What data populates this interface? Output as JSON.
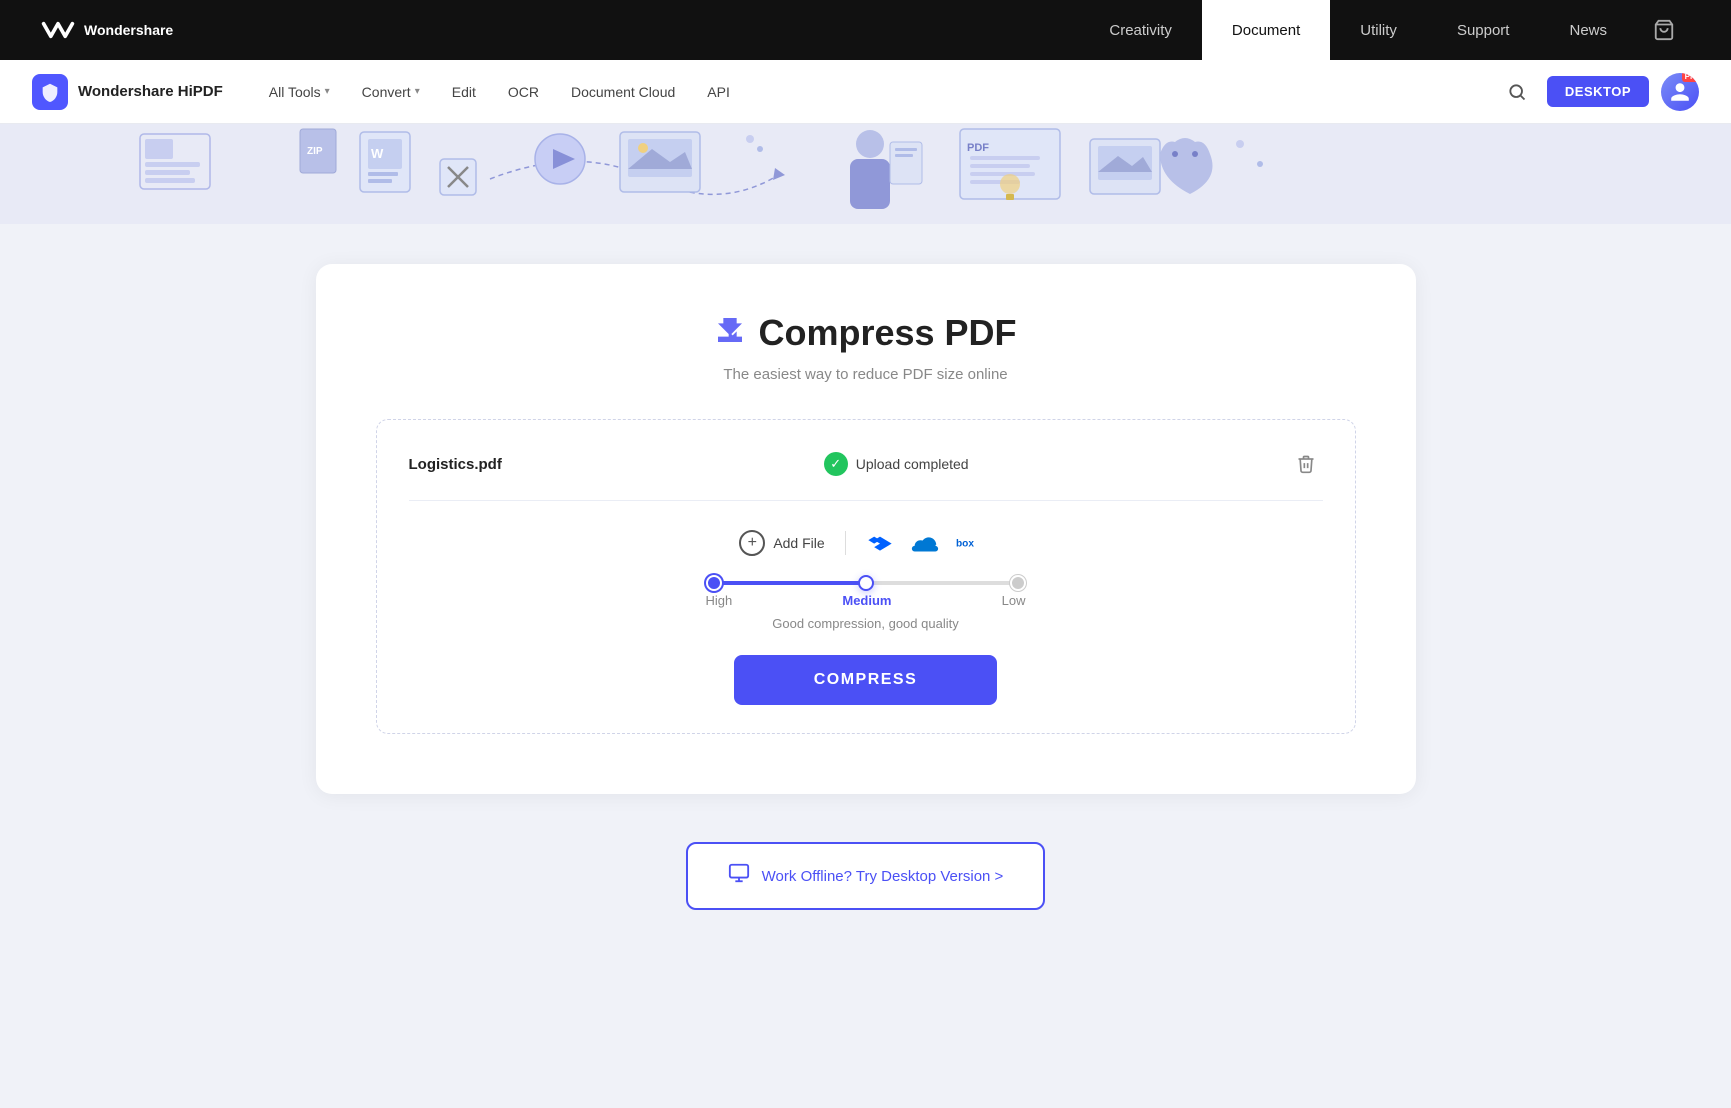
{
  "topNav": {
    "logo": "wondershare",
    "links": [
      {
        "id": "creativity",
        "label": "Creativity",
        "active": false
      },
      {
        "id": "document",
        "label": "Document",
        "active": true
      },
      {
        "id": "utility",
        "label": "Utility",
        "active": false
      },
      {
        "id": "support",
        "label": "Support",
        "active": false
      },
      {
        "id": "news",
        "label": "News",
        "active": false
      }
    ]
  },
  "secNav": {
    "brandName": "Wondershare HiPDF",
    "items": [
      {
        "id": "all-tools",
        "label": "All Tools",
        "hasDropdown": true
      },
      {
        "id": "convert",
        "label": "Convert",
        "hasDropdown": true
      },
      {
        "id": "edit",
        "label": "Edit",
        "hasDropdown": false
      },
      {
        "id": "ocr",
        "label": "OCR",
        "hasDropdown": false
      },
      {
        "id": "document-cloud",
        "label": "Document Cloud",
        "hasDropdown": false
      },
      {
        "id": "api",
        "label": "API",
        "hasDropdown": false
      }
    ],
    "desktopBtn": "DESKTOP",
    "proBadge": "Pro"
  },
  "page": {
    "title": "Compress PDF",
    "subtitle": "The easiest way to reduce PDF size online",
    "fileName": "Logistics.pdf",
    "uploadStatus": "Upload completed",
    "addFileLabel": "Add File",
    "compressionLevels": [
      {
        "id": "high",
        "label": "High"
      },
      {
        "id": "medium",
        "label": "Medium"
      },
      {
        "id": "low",
        "label": "Low"
      }
    ],
    "selectedLevel": "Medium",
    "compressionDesc": "Good compression, good quality",
    "compressBtn": "COMPRESS",
    "offlineBanner": "Work Offline? Try Desktop Version >"
  }
}
